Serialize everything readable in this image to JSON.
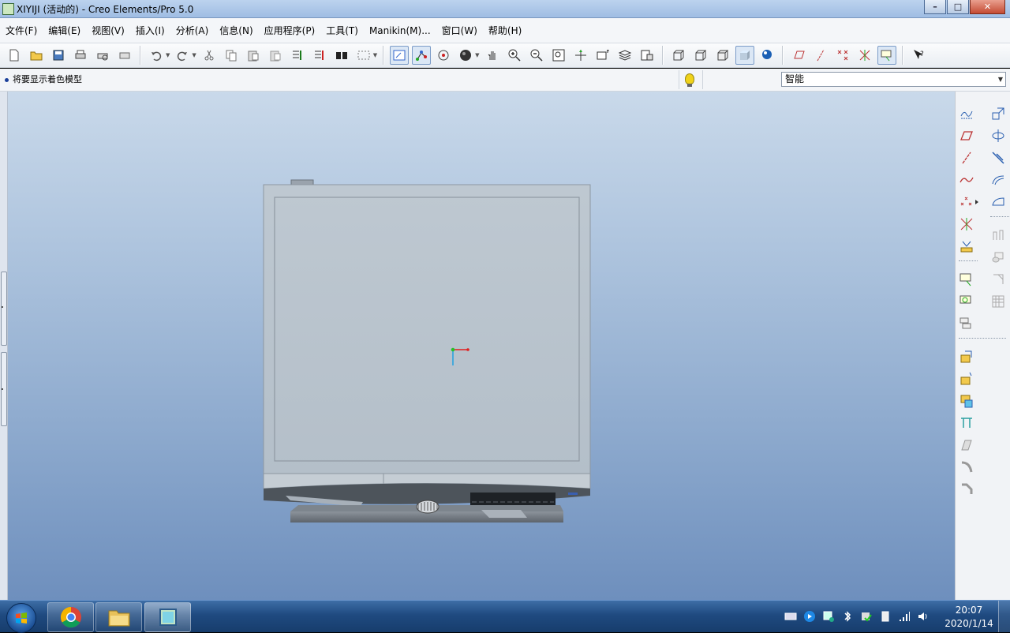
{
  "window": {
    "title": "XIYIJI (活动的) - Creo Elements/Pro 5.0",
    "min_label": "–",
    "max_label": "□",
    "close_label": "✕"
  },
  "menubar": {
    "items": [
      "文件(F)",
      "编辑(E)",
      "视图(V)",
      "插入(I)",
      "分析(A)",
      "信息(N)",
      "应用程序(P)",
      "工具(T)",
      "Manikin(M)...",
      "窗口(W)",
      "帮助(H)"
    ]
  },
  "toolbar": {
    "icons": [
      "new-file-icon",
      "open-folder-icon",
      "save-icon",
      "print-icon",
      "quick-print-icon",
      "close-window-icon",
      "undo-icon",
      "redo-icon",
      "cut-icon",
      "copy-icon",
      "paste-icon",
      "paste-special-icon",
      "regenerate-icon",
      "regen-manager-icon",
      "find-icon",
      "select-box-icon",
      "repaint-icon",
      "spin-center-icon",
      "orient-mode-icon",
      "display-style-icon",
      "pan-icon",
      "zoom-in-icon",
      "zoom-out-icon",
      "refit-icon",
      "reorient-icon",
      "saved-views-icon",
      "layers-icon",
      "view-manager-icon",
      "wireframe-icon",
      "hidden-line-icon",
      "no-hidden-icon",
      "shading-icon",
      "enhanced-realism-icon",
      "datum-planes-icon",
      "datum-axes-icon",
      "point-on-icon",
      "csys-on-icon",
      "annotation-on-icon",
      "whats-this-icon"
    ]
  },
  "messagebar": {
    "message": "将要显示着色模型",
    "filter_value": "智能"
  },
  "taskbar": {
    "time": "20:07",
    "date": "2020/1/14"
  },
  "colors": {
    "accent": "#7c9cc8",
    "model_body": "#b9c3cc",
    "background_top": "#c9d9ea",
    "background_bottom": "#6e8fbd"
  }
}
